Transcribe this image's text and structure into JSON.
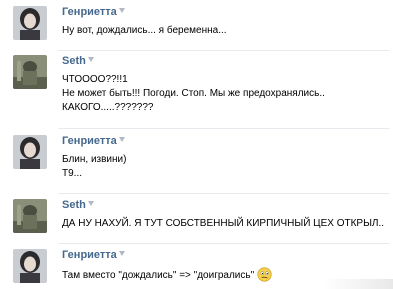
{
  "messages": [
    {
      "author": "Генриетта",
      "avatar_icon": "woman-photo",
      "lines": [
        "Ну вот, дождались... я беременна..."
      ]
    },
    {
      "author": "Seth",
      "avatar_icon": "soldier-photo",
      "lines": [
        "ЧТОООО??!!1",
        "Не может быть!!! Погоди. Стоп. Мы же предохранялись..",
        "КАКОГО.....???????"
      ]
    },
    {
      "author": "Генриетта",
      "avatar_icon": "woman-photo",
      "lines": [
        "Блин, извини)",
        "Т9..."
      ]
    },
    {
      "author": "Seth",
      "avatar_icon": "soldier-photo",
      "lines": [
        "ДА НУ НАХУЙ. Я ТУТ СОБСТВЕННЫЙ КИРПИЧНЫЙ ЦЕХ ОТКРЫЛ.."
      ]
    },
    {
      "author": "Генриетта",
      "avatar_icon": "woman-photo",
      "lines": [
        "Там вместо \"дождались\" => \"доигрались\""
      ],
      "emoji": "confused-smiley-icon"
    }
  ],
  "colors": {
    "author_link": "#45688e",
    "separator": "#e7ebf0",
    "caret": "#b1b9c3"
  }
}
